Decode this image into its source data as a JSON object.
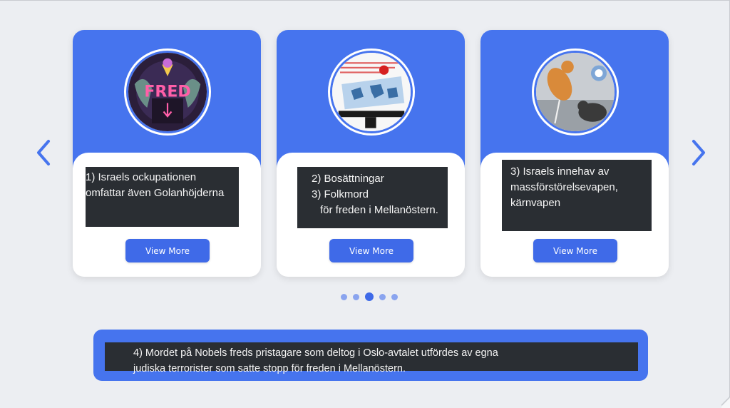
{
  "carousel": {
    "prev_icon": "chevron-left-icon",
    "next_icon": "chevron-right-icon",
    "accent_color": "#4674ee",
    "cards": [
      {
        "image": "fred-poster-image",
        "caption_lines": [
          "1) Israels ockupationen",
          "omfattar även Golanhöjderna"
        ],
        "button_label": "View More"
      },
      {
        "image": "map-document-image",
        "caption_lines": [
          "2) Bosättningar",
          "3) Folkmord",
          "för freden i Mellanöstern."
        ],
        "button_label": "View More"
      },
      {
        "image": "cats-image",
        "caption_lines": [
          "3) Israels innehav av",
          "massförstörelsevapen,",
          "kärnvapen"
        ],
        "button_label": "View More"
      }
    ],
    "dots": {
      "count": 5,
      "active_index": 2
    }
  },
  "banner": {
    "lines": [
      "4) Mordet på Nobels freds pristagare som deltog i Oslo-avtalet utfördes av egna",
      "judiska terrorister som satte stopp för freden i Mellanöstern."
    ]
  }
}
